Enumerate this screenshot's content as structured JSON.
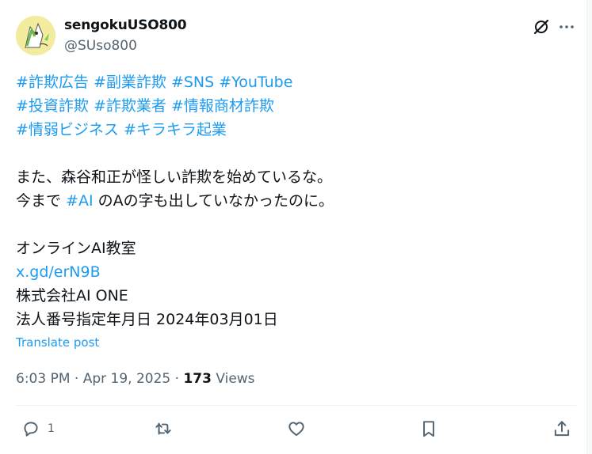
{
  "author": {
    "display_name": "sengokuUSO800",
    "handle": "@SUso800",
    "avatar_icon": "avatar-illustration"
  },
  "post": {
    "hashtags_line1": [
      "#詐欺広告",
      "#副業詐欺",
      "#SNS",
      "#YouTube"
    ],
    "hashtags_line2": [
      "#投資詐欺",
      "#詐欺業者",
      "#情報商材詐欺"
    ],
    "hashtags_line3": [
      "#情弱ビジネス",
      "#キラキラ起業"
    ],
    "line_a": "また、森谷和正が怪しい詐欺を始めているな。",
    "line_b_pre": "今まで ",
    "line_b_tag": "#AI",
    "line_b_post": " のAの字も出していなかったのに。",
    "line_c": "オンラインAI教室",
    "link": "x.gd/erN9B",
    "line_d": "株式会社AI ONE",
    "line_e": "法人番号指定年月日 2024年03月01日"
  },
  "translate_label": "Translate post",
  "meta": {
    "time_date": "6:03 PM · Apr 19, 2025 · ",
    "views_count": "173",
    "views_label": " Views"
  },
  "actions": {
    "reply_count": "1",
    "icons": [
      "reply-icon",
      "retweet-icon",
      "like-icon",
      "bookmark-icon",
      "share-icon"
    ]
  },
  "colors": {
    "link": "#1d9bf0",
    "text": "#0f1419",
    "secondary": "#536471",
    "divider": "#eff3f4"
  }
}
